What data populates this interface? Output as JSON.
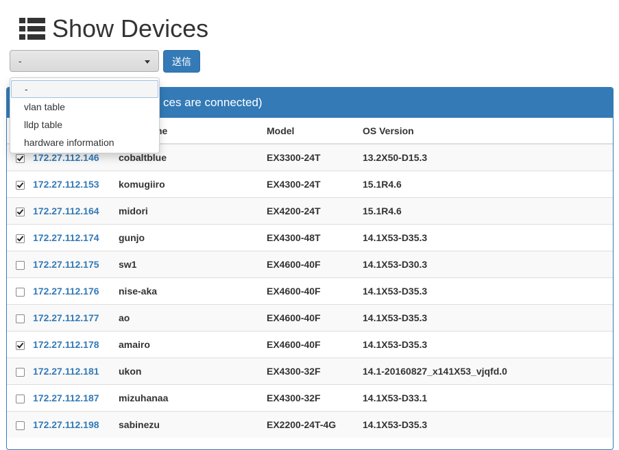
{
  "page": {
    "title": "Show Devices",
    "title_icon": "list-icon"
  },
  "form": {
    "select_value": "-",
    "submit_label": "送信",
    "options": [
      "-",
      "vlan table",
      "lldp table",
      "hardware information"
    ]
  },
  "panel": {
    "heading": "ces are connected)"
  },
  "table": {
    "columns": [
      "",
      "",
      "ne",
      "Model",
      "OS Version"
    ],
    "rows": [
      {
        "checked": true,
        "ip": "172.27.112.146",
        "hostname": "cobaltblue",
        "model": "EX3300-24T",
        "os": "13.2X50-D15.3"
      },
      {
        "checked": true,
        "ip": "172.27.112.153",
        "hostname": "komugiiro",
        "model": "EX4300-24T",
        "os": "15.1R4.6"
      },
      {
        "checked": true,
        "ip": "172.27.112.164",
        "hostname": "midori",
        "model": "EX4200-24T",
        "os": "15.1R4.6"
      },
      {
        "checked": true,
        "ip": "172.27.112.174",
        "hostname": "gunjo",
        "model": "EX4300-48T",
        "os": "14.1X53-D35.3"
      },
      {
        "checked": false,
        "ip": "172.27.112.175",
        "hostname": "sw1",
        "model": "EX4600-40F",
        "os": "14.1X53-D30.3"
      },
      {
        "checked": false,
        "ip": "172.27.112.176",
        "hostname": "nise-aka",
        "model": "EX4600-40F",
        "os": "14.1X53-D35.3"
      },
      {
        "checked": false,
        "ip": "172.27.112.177",
        "hostname": "ao",
        "model": "EX4600-40F",
        "os": "14.1X53-D35.3"
      },
      {
        "checked": true,
        "ip": "172.27.112.178",
        "hostname": "amairo",
        "model": "EX4600-40F",
        "os": "14.1X53-D35.3"
      },
      {
        "checked": false,
        "ip": "172.27.112.181",
        "hostname": "ukon",
        "model": "EX4300-32F",
        "os": "14.1-20160827_x141X53_vjqfd.0"
      },
      {
        "checked": false,
        "ip": "172.27.112.187",
        "hostname": "mizuhanaa",
        "model": "EX4300-32F",
        "os": "14.1X53-D33.1"
      },
      {
        "checked": false,
        "ip": "172.27.112.198",
        "hostname": "sabinezu",
        "model": "EX2200-24T-4G",
        "os": "14.1X53-D35.3"
      }
    ]
  },
  "colors": {
    "primary": "#337ab7",
    "link": "#337ab7"
  }
}
